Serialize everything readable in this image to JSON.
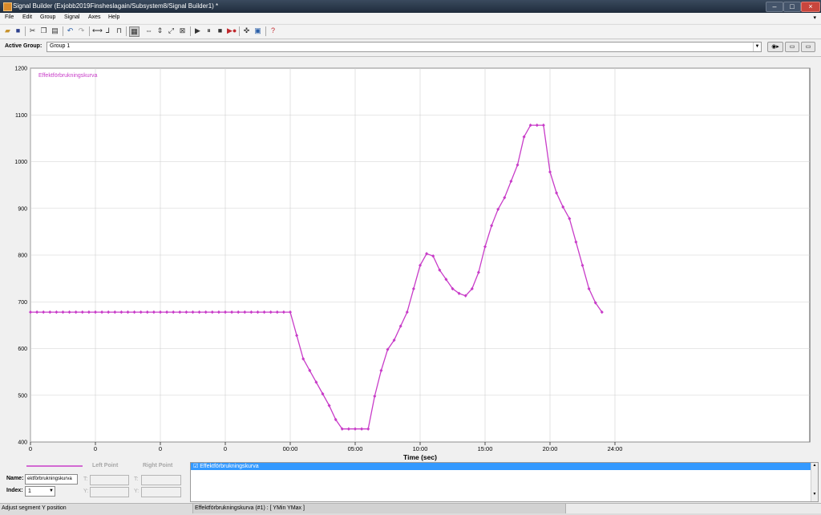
{
  "window": {
    "title": "Signal Builder (Exjobb2019Finsheslagain/Subsystem8/Signal Builder1) *",
    "controls": [
      "–",
      "□",
      "×"
    ]
  },
  "menubar": {
    "items": [
      "File",
      "Edit",
      "Group",
      "Signal",
      "Axes",
      "Help"
    ],
    "overflow_arrow": "▾"
  },
  "toolbar": {
    "icons": [
      "open-icon",
      "save-icon",
      "cut-icon",
      "copy-icon",
      "paste-icon",
      "undo-icon",
      "redo-icon",
      "line-icon",
      "step-up-icon",
      "pulse-icon",
      "grid-select-icon",
      "zoom-x-icon",
      "zoom-y-icon",
      "zoom-xy-icon",
      "full-view-icon",
      "play-icon",
      "pause-icon",
      "stop-icon",
      "record-icon",
      "move-icon",
      "show-block-icon",
      "help-icon"
    ]
  },
  "group": {
    "label": "Active Group:",
    "value": "Group 1",
    "buttons": [
      "◉▸",
      "▭",
      "▭"
    ]
  },
  "chart_data": {
    "type": "line",
    "legend_label": "Effektförbrukningskurva",
    "xlabel": "Time (sec)",
    "ylabel": "",
    "xlim": [
      0,
      48
    ],
    "ylim": [
      400,
      1200
    ],
    "x_ticks": [
      0,
      4,
      8,
      12,
      16,
      20,
      24,
      28,
      32,
      36
    ],
    "x_tick_labels": [
      "0",
      "0",
      "0",
      "0",
      "00:00",
      "05:00",
      "10:00",
      "15:00",
      "20:00",
      "24:00"
    ],
    "y_ticks": [
      400,
      500,
      600,
      700,
      800,
      900,
      1000,
      1100,
      1200
    ],
    "y_tick_labels": [
      "400",
      "500",
      "600",
      "700",
      "800",
      "900",
      "1000",
      "1100",
      "1200"
    ],
    "color": "#c83cc8",
    "grid": true,
    "series": [
      {
        "name": "Effektförbrukningskurva",
        "points": [
          [
            0,
            678
          ],
          [
            0.4,
            678
          ],
          [
            0.8,
            678
          ],
          [
            1.2,
            678
          ],
          [
            1.6,
            678
          ],
          [
            2.0,
            678
          ],
          [
            2.4,
            678
          ],
          [
            2.8,
            678
          ],
          [
            3.2,
            678
          ],
          [
            3.6,
            678
          ],
          [
            4.0,
            678
          ],
          [
            4.4,
            678
          ],
          [
            4.8,
            678
          ],
          [
            5.2,
            678
          ],
          [
            5.6,
            678
          ],
          [
            6.0,
            678
          ],
          [
            6.4,
            678
          ],
          [
            6.8,
            678
          ],
          [
            7.2,
            678
          ],
          [
            7.6,
            678
          ],
          [
            8.0,
            678
          ],
          [
            8.4,
            678
          ],
          [
            8.8,
            678
          ],
          [
            9.2,
            678
          ],
          [
            9.6,
            678
          ],
          [
            10.0,
            678
          ],
          [
            10.4,
            678
          ],
          [
            10.8,
            678
          ],
          [
            11.2,
            678
          ],
          [
            11.6,
            678
          ],
          [
            12.0,
            678
          ],
          [
            12.4,
            678
          ],
          [
            12.8,
            678
          ],
          [
            13.2,
            678
          ],
          [
            13.6,
            678
          ],
          [
            14.0,
            678
          ],
          [
            14.4,
            678
          ],
          [
            14.8,
            678
          ],
          [
            15.2,
            678
          ],
          [
            15.6,
            678
          ],
          [
            16.0,
            678
          ],
          [
            16.4,
            628
          ],
          [
            16.8,
            578
          ],
          [
            17.2,
            553
          ],
          [
            17.6,
            528
          ],
          [
            18.0,
            503
          ],
          [
            18.4,
            478
          ],
          [
            18.8,
            448
          ],
          [
            19.2,
            428
          ],
          [
            19.6,
            428
          ],
          [
            20.0,
            428
          ],
          [
            20.4,
            428
          ],
          [
            20.8,
            428
          ],
          [
            21.2,
            498
          ],
          [
            21.6,
            553
          ],
          [
            22.0,
            598
          ],
          [
            22.4,
            618
          ],
          [
            22.8,
            648
          ],
          [
            23.2,
            678
          ],
          [
            23.6,
            728
          ],
          [
            24.0,
            778
          ],
          [
            24.4,
            803
          ],
          [
            24.8,
            798
          ],
          [
            25.2,
            768
          ],
          [
            25.6,
            748
          ],
          [
            26.0,
            728
          ],
          [
            26.4,
            718
          ],
          [
            26.8,
            713
          ],
          [
            27.2,
            728
          ],
          [
            27.6,
            763
          ],
          [
            28.0,
            818
          ],
          [
            28.4,
            863
          ],
          [
            28.8,
            898
          ],
          [
            29.2,
            923
          ],
          [
            29.6,
            958
          ],
          [
            30.0,
            993
          ],
          [
            30.4,
            1053
          ],
          [
            30.8,
            1078
          ],
          [
            31.2,
            1078
          ],
          [
            31.6,
            1078
          ],
          [
            32.0,
            978
          ],
          [
            32.4,
            933
          ],
          [
            32.8,
            903
          ],
          [
            33.2,
            878
          ],
          [
            33.6,
            828
          ],
          [
            34.0,
            778
          ],
          [
            34.4,
            728
          ],
          [
            34.8,
            698
          ],
          [
            35.2,
            678
          ]
        ]
      }
    ]
  },
  "bottom": {
    "left_point_label": "Left Point",
    "right_point_label": "Right Point",
    "name_label": "Name:",
    "name_value": "ektförbrukningskurva",
    "index_label": "Index:",
    "index_value": "1",
    "t_label": "T:",
    "y_label": "Y:",
    "signal_list": [
      "☑ Effektförbrukningskurva"
    ]
  },
  "status": {
    "left": "Adjust segment Y position",
    "middle": "Effektförbrukningskurva (#1) : [ YMin YMax ]"
  }
}
